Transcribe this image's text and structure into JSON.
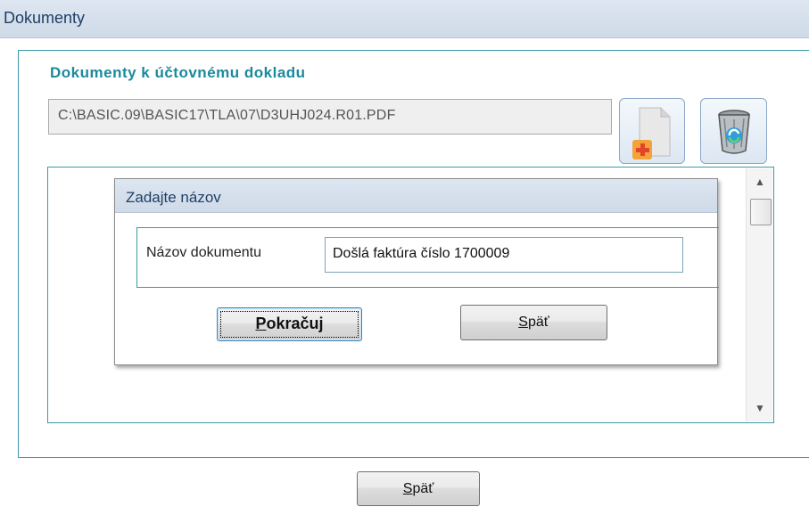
{
  "window": {
    "title": "Dokumenty"
  },
  "documents": {
    "heading": "Dokumenty k účtovnému dokladu",
    "path_value": "C:\\BASIC.09\\BASIC17\\TLA\\07\\D3UHJ024.R01.PDF",
    "add_icon": "add-document-icon",
    "delete_icon": "recycle-bin-icon"
  },
  "dialog": {
    "title": "Zadajte názov",
    "name_label": "Názov dokumentu",
    "name_value": "Došlá faktúra číslo 1700009",
    "continue_hotkey": "P",
    "continue_rest": "okračuj",
    "back_hotkey": "S",
    "back_rest": "päť"
  },
  "footer": {
    "back_hotkey": "S",
    "back_rest": "päť"
  },
  "colors": {
    "accent": "#3b9aa8",
    "heading": "#1a8a9e",
    "title_bar": "#d6e0ec"
  }
}
